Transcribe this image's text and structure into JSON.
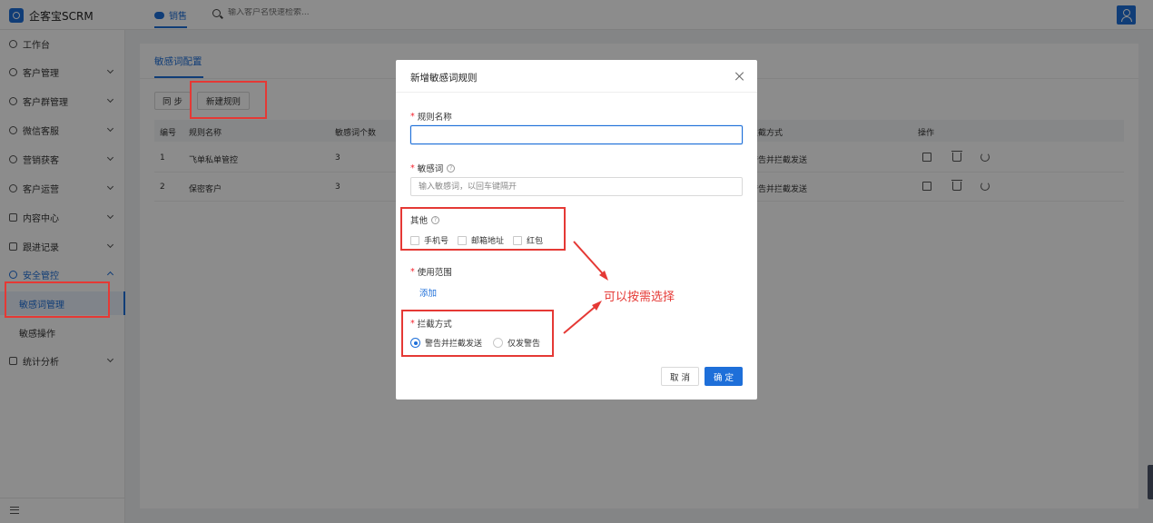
{
  "app": {
    "logo_text": "企客宝SCRM"
  },
  "topbar": {
    "tab_label": "销售",
    "search_placeholder": "输入客户名快速检索..."
  },
  "sidebar": {
    "items": [
      {
        "label": "工作台",
        "icon": "dashboard-icon"
      },
      {
        "label": "客户管理",
        "icon": "customer-icon"
      },
      {
        "label": "客户群管理",
        "icon": "group-icon"
      },
      {
        "label": "微信客服",
        "icon": "wechat-service-icon"
      },
      {
        "label": "营销获客",
        "icon": "marketing-icon"
      },
      {
        "label": "客户运营",
        "icon": "operation-icon"
      },
      {
        "label": "内容中心",
        "icon": "content-icon"
      },
      {
        "label": "跟进记录",
        "icon": "record-icon"
      },
      {
        "label": "安全管控",
        "icon": "shield-icon"
      },
      {
        "label": "统计分析",
        "icon": "chart-icon"
      }
    ],
    "sub_items": [
      "敏感词管理",
      "敏感操作"
    ]
  },
  "page": {
    "tab_label": "敏感词配置",
    "btn_sync": "同 步",
    "btn_new": "新建规则",
    "columns": [
      "编号",
      "规则名称",
      "敏感词个数",
      "拦截方式",
      "操作"
    ],
    "rows": [
      {
        "no": "1",
        "name": "飞单私单管控",
        "count": "3",
        "mode": "警告并拦截发送"
      },
      {
        "no": "2",
        "name": "保密客户",
        "count": "3",
        "mode": "警告并拦截发送"
      }
    ]
  },
  "modal": {
    "title": "新增敏感词规则",
    "rule_name_label": "规则名称",
    "rule_name_value": "",
    "keywords_label": "敏感词",
    "keywords_placeholder": "输入敏感词，以回车键隔开",
    "other_label": "其他",
    "other_options": [
      "手机号",
      "邮箱地址",
      "红包"
    ],
    "scope_label": "使用范围",
    "scope_add": "添加",
    "intercept_label": "拦截方式",
    "intercept_options": [
      "警告并拦截发送",
      "仅发警告"
    ],
    "cancel_label": "取 消",
    "ok_label": "确 定"
  },
  "annotation": {
    "text": "可以按需选择",
    "color": "#e53935"
  },
  "colors": {
    "primary": "#1e6fd9",
    "required": "#f5222d"
  }
}
